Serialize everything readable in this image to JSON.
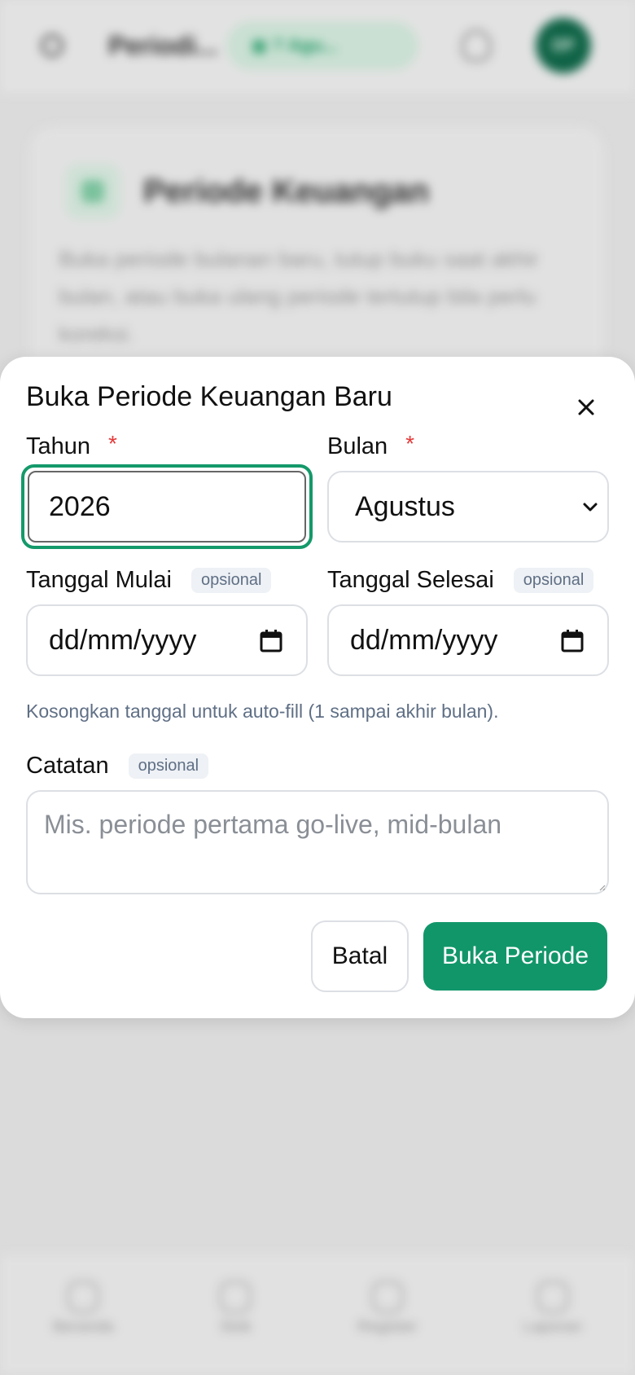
{
  "background": {
    "app_title": "Periodi...",
    "period_pill": "▣ ? Agu...",
    "avatar_initials": "DP",
    "card_title": "Periode Keuangan",
    "card_description": "Buka periode bulanan baru, tutup buku saat akhir bulan, atau buka ulang periode tertutup bila perlu koreksi.",
    "nav_items": [
      "Beranda",
      "Stok",
      "Register",
      "Laporan"
    ]
  },
  "modal": {
    "title": "Buka Periode Keuangan Baru",
    "year": {
      "label": "Tahun",
      "required_mark": "*",
      "value": "2026"
    },
    "month": {
      "label": "Bulan",
      "required_mark": "*",
      "selected": "Agustus"
    },
    "start_date": {
      "label": "Tanggal Mulai",
      "badge": "opsional",
      "placeholder": "dd/mm/yyyy"
    },
    "end_date": {
      "label": "Tanggal Selesai",
      "badge": "opsional",
      "placeholder": "dd/mm/yyyy"
    },
    "hint": "Kosongkan tanggal untuk auto-fill (1 sampai akhir bulan).",
    "notes": {
      "label": "Catatan",
      "badge": "opsional",
      "placeholder": "Mis. periode pertama go-live, mid-bulan"
    },
    "cancel_label": "Batal",
    "submit_label": "Buka Periode"
  },
  "colors": {
    "primary": "#11966a",
    "focus_ring": "#14996a",
    "required": "#e53a3a",
    "badge_bg": "#eef1f5",
    "muted_text": "#5f6f85"
  },
  "icons": {
    "close": "close-icon",
    "month_dropdown": "chevron-down-icon",
    "date_picker": "calendar-icon"
  }
}
